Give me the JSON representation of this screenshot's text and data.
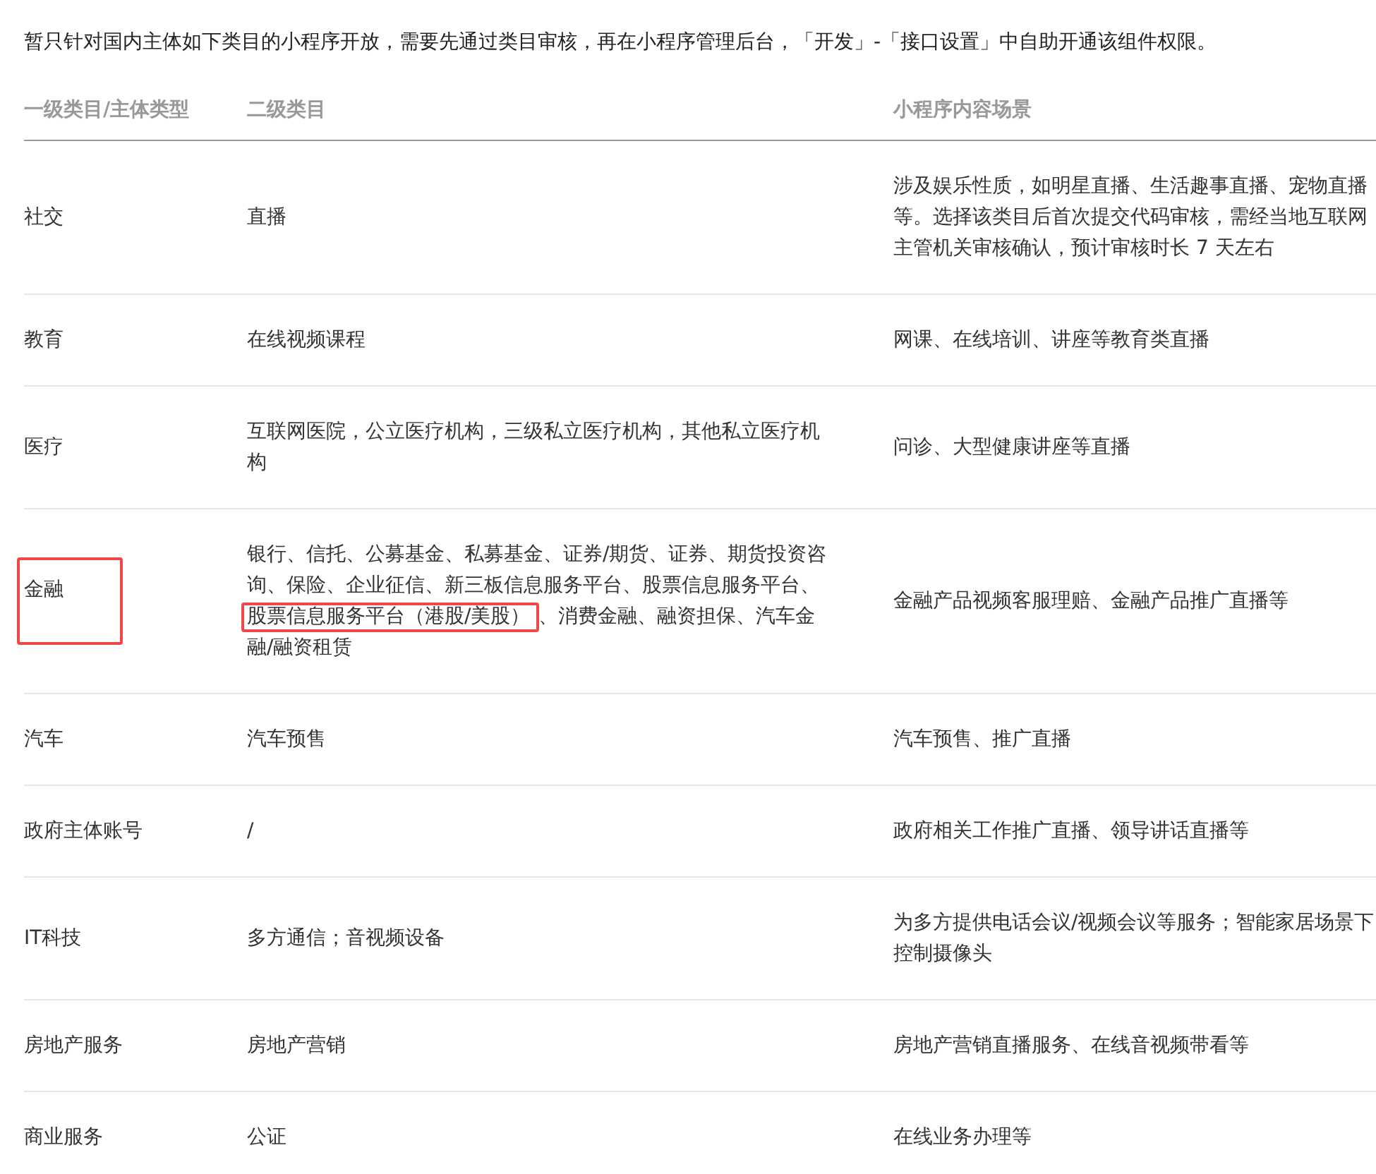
{
  "intro": "暂只针对国内主体如下类目的小程序开放，需要先通过类目审核，再在小程序管理后台，「开发」-「接口设置」中自助开通该组件权限。",
  "table": {
    "columns": [
      "一级类目/主体类型",
      "二级类目",
      "小程序内容场景"
    ],
    "rows": [
      {
        "category": {
          "text": "社交",
          "highlighted": false
        },
        "subcategory": [
          {
            "text": "直播",
            "highlighted": false
          }
        ],
        "scene": "涉及娱乐性质，如明星直播、生活趣事直播、宠物直播等。选择该类目后首次提交代码审核，需经当地互联网主管机关审核确认，预计审核时长 7 天左右"
      },
      {
        "category": {
          "text": "教育",
          "highlighted": false
        },
        "subcategory": [
          {
            "text": "在线视频课程",
            "highlighted": false
          }
        ],
        "scene": "网课、在线培训、讲座等教育类直播"
      },
      {
        "category": {
          "text": "医疗",
          "highlighted": false
        },
        "subcategory": [
          {
            "text": "互联网医院，公立医疗机构，三级私立医疗机构，其他私立医疗机构",
            "highlighted": false
          }
        ],
        "scene": "问诊、大型健康讲座等直播"
      },
      {
        "category": {
          "text": "金融",
          "highlighted": true
        },
        "subcategory": [
          {
            "text": "银行、信托、公募基金、私募基金、证券/期货、证券、期货投资咨询、保险、企业征信、新三板信息服务平台、股票信息服务平台、",
            "highlighted": false
          },
          {
            "text": "股票信息服务平台（港股/美股）",
            "highlighted": true
          },
          {
            "text": "、消费金融、融资担保、汽车金融/融资租赁",
            "highlighted": false
          }
        ],
        "scene": "金融产品视频客服理赔、金融产品推广直播等"
      },
      {
        "category": {
          "text": "汽车",
          "highlighted": false
        },
        "subcategory": [
          {
            "text": "汽车预售",
            "highlighted": false
          }
        ],
        "scene": "汽车预售、推广直播"
      },
      {
        "category": {
          "text": "政府主体账号",
          "highlighted": false
        },
        "subcategory": [
          {
            "text": "/",
            "highlighted": false
          }
        ],
        "scene": "政府相关工作推广直播、领导讲话直播等"
      },
      {
        "category": {
          "text": "IT科技",
          "highlighted": false
        },
        "subcategory": [
          {
            "text": "多方通信；音视频设备",
            "highlighted": false
          }
        ],
        "scene": "为多方提供电话会议/视频会议等服务；智能家居场景下控制摄像头"
      },
      {
        "category": {
          "text": "房地产服务",
          "highlighted": false
        },
        "subcategory": [
          {
            "text": "房地产营销",
            "highlighted": false
          }
        ],
        "scene": "房地产营销直播服务、在线音视频带看等"
      },
      {
        "category": {
          "text": "商业服务",
          "highlighted": false
        },
        "subcategory": [
          {
            "text": "公证",
            "highlighted": false
          }
        ],
        "scene": "在线业务办理等"
      }
    ]
  }
}
